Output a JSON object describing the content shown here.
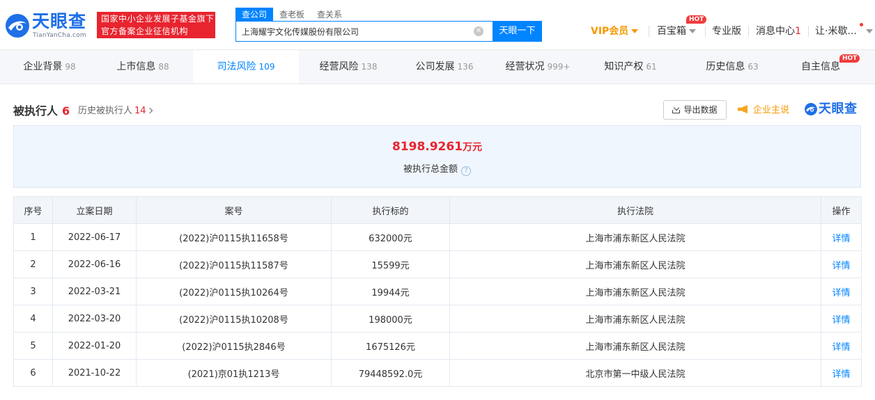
{
  "header": {
    "logo_text": "天眼查",
    "logo_sub": "TianYanCha.com",
    "slogan_line1": "国家中小企业发展子基金旗下",
    "slogan_line2": "官方备案企业征信机构",
    "search_tabs": [
      "查公司",
      "查老板",
      "查关系"
    ],
    "search_value": "上海耀宇文化传媒股份有限公司",
    "search_button": "天眼一下",
    "vip": "VIP会员",
    "baibaoxiang": "百宝箱",
    "hot": "HOT",
    "pro": "专业版",
    "messages": "消息中心",
    "messages_count": "1",
    "user": "让·米歇..."
  },
  "tabs": [
    {
      "label": "企业背景",
      "count": "98"
    },
    {
      "label": "上市信息",
      "count": "88"
    },
    {
      "label": "司法风险",
      "count": "109"
    },
    {
      "label": "经营风险",
      "count": "138"
    },
    {
      "label": "公司发展",
      "count": "136"
    },
    {
      "label": "经营状况",
      "count": "999+"
    },
    {
      "label": "知识产权",
      "count": "61"
    },
    {
      "label": "历史信息",
      "count": "63"
    },
    {
      "label": "自主信息",
      "count": ""
    }
  ],
  "tab_hot": "HOT",
  "section": {
    "title": "被执行人",
    "count": "6",
    "history_label": "历史被执行人",
    "history_count": "14",
    "export": "导出数据",
    "speak": "企业主说",
    "brand": "天眼查"
  },
  "summary": {
    "amount": "8198.9261",
    "unit": "万元",
    "label": "被执行总金额",
    "help": "?"
  },
  "table": {
    "headers": [
      "序号",
      "立案日期",
      "案号",
      "执行标的",
      "执行法院",
      "操作"
    ],
    "rows": [
      [
        "1",
        "2022-06-17",
        "(2022)沪0115执11658号",
        "632000元",
        "上海市浦东新区人民法院",
        "详情"
      ],
      [
        "2",
        "2022-06-16",
        "(2022)沪0115执11587号",
        "15599元",
        "上海市浦东新区人民法院",
        "详情"
      ],
      [
        "3",
        "2022-03-21",
        "(2022)沪0115执10264号",
        "19944元",
        "上海市浦东新区人民法院",
        "详情"
      ],
      [
        "4",
        "2022-03-20",
        "(2022)沪0115执10208号",
        "198000元",
        "上海市浦东新区人民法院",
        "详情"
      ],
      [
        "5",
        "2022-01-20",
        "(2022)沪0115执2846号",
        "1675126元",
        "上海市浦东新区人民法院",
        "详情"
      ],
      [
        "6",
        "2021-10-22",
        "(2021)京01执1213号",
        "79448592.0元",
        "北京市第一中级人民法院",
        "详情"
      ]
    ]
  },
  "colors": {
    "brand_blue": "#0084ff",
    "red": "#e8242f",
    "vip_orange": "#f59a00"
  }
}
